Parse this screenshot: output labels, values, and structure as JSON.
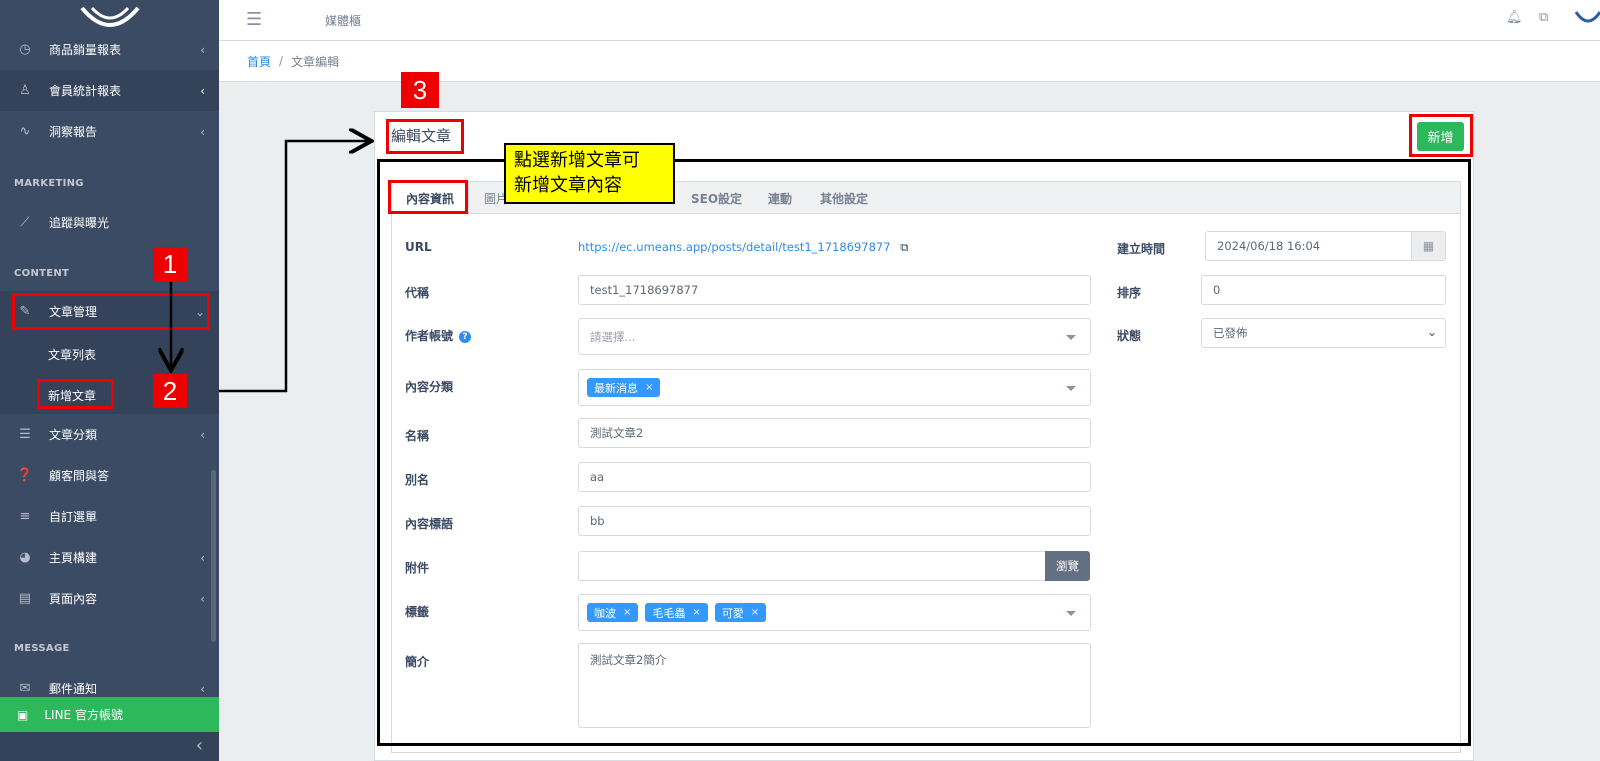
{
  "header": {
    "title": "媒體櫃"
  },
  "breadcrumb": {
    "home": "首頁",
    "separator": "/",
    "current": "文章編輯"
  },
  "sidebar": {
    "items": [
      {
        "label": "商品銷量報表",
        "icon": "clock-icon"
      },
      {
        "label": "會員統計報表",
        "icon": "user-icon"
      },
      {
        "label": "洞察報告",
        "icon": "insight-icon"
      },
      {
        "label": "追蹤與曝光",
        "icon": "chart-line-icon"
      },
      {
        "label": "文章管理",
        "icon": "pencil-icon"
      },
      {
        "label": "文章分類",
        "icon": "list-icon"
      },
      {
        "label": "顧客問與答",
        "icon": "question-icon"
      },
      {
        "label": "自訂選單",
        "icon": "menu-icon"
      },
      {
        "label": "主頁構建",
        "icon": "palette-icon"
      },
      {
        "label": "頁面內容",
        "icon": "file-icon"
      },
      {
        "label": "郵件通知",
        "icon": "mail-icon"
      }
    ],
    "sections": {
      "marketing": "MARKETING",
      "content": "CONTENT",
      "message": "MESSAGE"
    },
    "subitems": {
      "list": "文章列表",
      "new": "新增文章"
    },
    "line": "LINE 官方帳號"
  },
  "card": {
    "title": "編輯文章",
    "add_button": "新增"
  },
  "tabs": [
    "內容資訊",
    "圖片",
    "SEO設定",
    "連動",
    "其他設定"
  ],
  "form": {
    "url_label": "URL",
    "url_value": "https://ec.umeans.app/posts/detail/test1_1718697877",
    "code_label": "代稱",
    "code_value": "test1_1718697877",
    "author_label": "作者帳號",
    "author_placeholder": "請選擇...",
    "category_label": "內容分類",
    "category_tags": [
      "最新消息"
    ],
    "name_label": "名稱",
    "name_value": "測試文章2",
    "alias_label": "別名",
    "alias_value": "aa",
    "subtitle_label": "內容標語",
    "subtitle_value": "bb",
    "attach_label": "附件",
    "browse_label": "瀏覽",
    "tags_label": "標籤",
    "tags": [
      "咖波",
      "毛毛蟲",
      "可愛"
    ],
    "intro_label": "簡介",
    "intro_value": "測試文章2簡介",
    "created_label": "建立時間",
    "created_value": "2024/06/18 16:04",
    "order_label": "排序",
    "order_value": "0",
    "status_label": "狀態",
    "status_value": "已發佈"
  },
  "annotations": {
    "num1": "1",
    "num2": "2",
    "num3": "3",
    "callout_line1": "點選新增文章可",
    "callout_line2": "新增文章內容"
  },
  "colors": {
    "sidebar": "#3c4b64",
    "success": "#2eb85c",
    "link": "#2d8ced",
    "tag": "#3399ff",
    "annotation": "#ee0000"
  }
}
